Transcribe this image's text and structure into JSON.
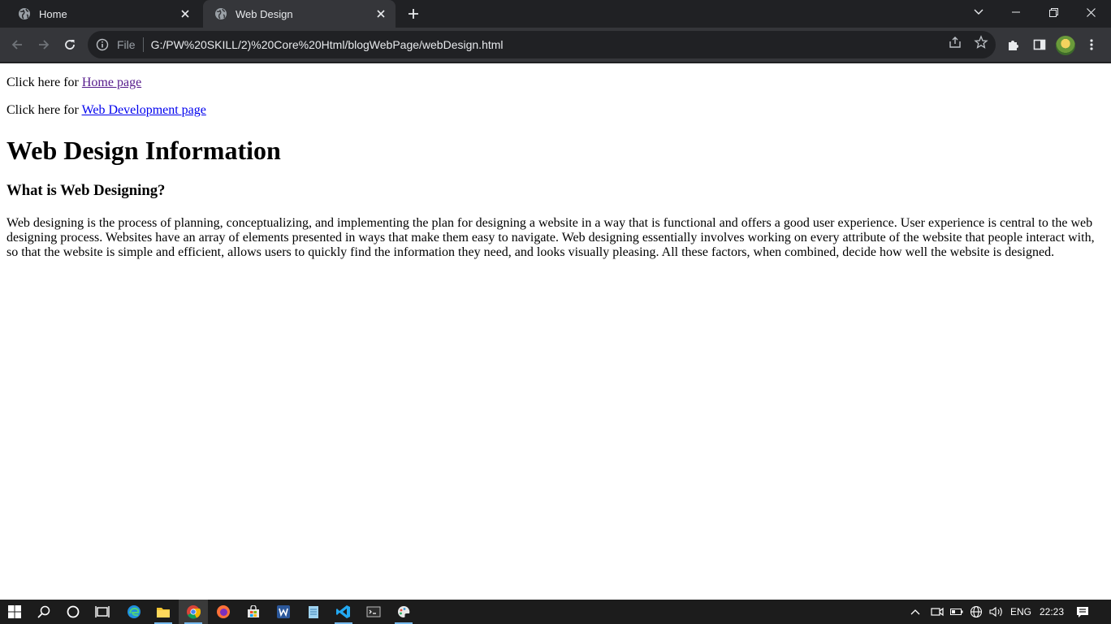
{
  "tabs": [
    {
      "label": "Home",
      "active": false
    },
    {
      "label": "Web Design",
      "active": true
    }
  ],
  "omnibox": {
    "scheme_label": "File",
    "url": "G:/PW%20SKILL/2)%20Core%20Html/blogWebPage/webDesign.html"
  },
  "page": {
    "nav_links": [
      {
        "prefix": "Click here for ",
        "link_text": "Home page"
      },
      {
        "prefix": "Click here for ",
        "link_text": "Web Development page"
      }
    ],
    "heading": "Web Design Information",
    "subheading": "What is Web Designing?",
    "paragraph": "Web designing is the process of planning, conceptualizing, and implementing the plan for designing a website in a way that is functional and offers a good user experience. User experience is central to the web designing process. Websites have an array of elements presented in ways that make them easy to navigate. Web designing essentially involves working on every attribute of the website that people interact with, so that the website is simple and efficient, allows users to quickly find the information they need, and looks visually pleasing. All these factors, when combined, decide how well the website is designed."
  },
  "taskbar": {
    "language": "ENG",
    "time": "22:23"
  },
  "colors": {
    "tabstrip_bg": "#202124",
    "toolbar_bg": "#35363a",
    "visited_link": "#551a8b",
    "link": "#0000ee",
    "taskbar_bg": "#1c1c1c"
  }
}
